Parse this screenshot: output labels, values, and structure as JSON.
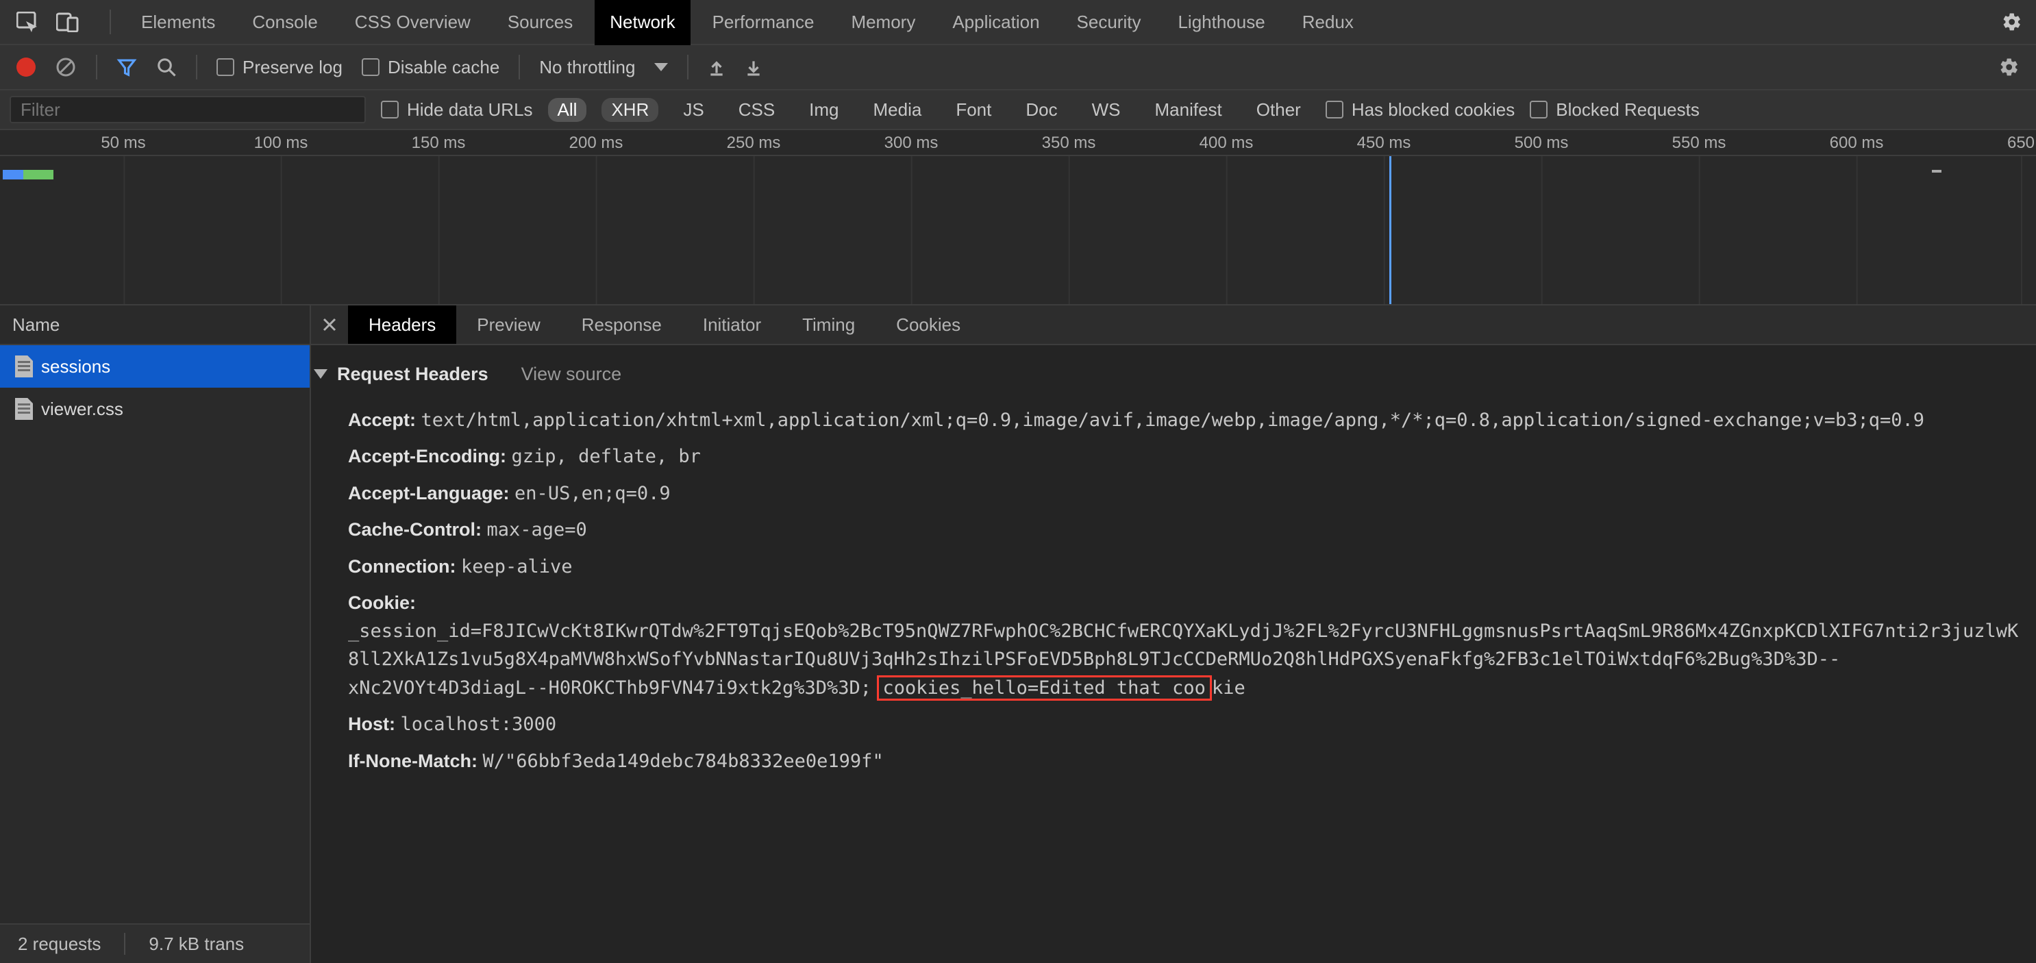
{
  "topTabs": {
    "items": [
      "Elements",
      "Console",
      "CSS Overview",
      "Sources",
      "Network",
      "Performance",
      "Memory",
      "Application",
      "Security",
      "Lighthouse",
      "Redux"
    ],
    "activeIndex": 4
  },
  "toolbar": {
    "preserveLog": "Preserve log",
    "disableCache": "Disable cache",
    "throttling": "No throttling"
  },
  "filterRow": {
    "placeholder": "Filter",
    "hideDataUrls": "Hide data URLs",
    "types": [
      "All",
      "XHR",
      "JS",
      "CSS",
      "Img",
      "Media",
      "Font",
      "Doc",
      "WS",
      "Manifest",
      "Other"
    ],
    "typeActiveIndex": 0,
    "typeSemiIndex": 1,
    "hasBlockedCookies": "Has blocked cookies",
    "blockedRequests": "Blocked Requests"
  },
  "timeline": {
    "ticks": [
      "50 ms",
      "100 ms",
      "150 ms",
      "200 ms",
      "250 ms",
      "300 ms",
      "350 ms",
      "400 ms",
      "450 ms",
      "500 ms",
      "550 ms",
      "600 ms",
      "650"
    ]
  },
  "sidebar": {
    "header": "Name",
    "requests": [
      {
        "name": "sessions",
        "selected": true
      },
      {
        "name": "viewer.css",
        "selected": false
      }
    ]
  },
  "detailTabs": {
    "items": [
      "Headers",
      "Preview",
      "Response",
      "Initiator",
      "Timing",
      "Cookies"
    ],
    "activeIndex": 0
  },
  "section": {
    "title": "Request Headers",
    "viewSource": "View source"
  },
  "headers": {
    "accept": {
      "name": "Accept:",
      "value": "text/html,application/xhtml+xml,application/xml;q=0.9,image/avif,image/webp,image/apng,*/*;q=0.8,application/signed-exchange;v=b3;q=0.9"
    },
    "acceptEncoding": {
      "name": "Accept-Encoding:",
      "value": "gzip, deflate, br"
    },
    "acceptLanguage": {
      "name": "Accept-Language:",
      "value": "en-US,en;q=0.9"
    },
    "cacheControl": {
      "name": "Cache-Control:",
      "value": "max-age=0"
    },
    "connection": {
      "name": "Connection:",
      "value": "keep-alive"
    },
    "cookie": {
      "name": "Cookie:",
      "pre": "_session_id=F8JICwVcKt8IKwrQTdw%2FT9TqjsEQob%2BcT95nQWZ7RFwphOC%2BCHCfwERCQYXaKLydjJ%2FL%2FyrcU3NFHLggmsnusPsrtAaqSmL9R86Mx4ZGnxpKCDlXIFG7nti2r3juzlwK8ll2XkA1Zs1vu5g8X4paMVW8hxWSofYvbNNastarIQu8UVj3qHh2sIhzilPSFoEVD5Bph8L9TJcCCDeRMUo2Q8hlHdPGXSyenaFkfg%2FB3c1elTOiWxtdqF6%2Bug%3D%3D--xNc2VOYt4D3diagL--H0ROKCThb9FVN47i9xtk2g%3D%3D;",
      "highlight": "cookies_hello=Edited that coo",
      "post": "kie"
    },
    "host": {
      "name": "Host:",
      "value": "localhost:3000"
    },
    "ifNoneMatch": {
      "name": "If-None-Match:",
      "value": "W/\"66bbf3eda149debc784b8332ee0e199f\""
    }
  },
  "status": {
    "requests": "2 requests",
    "transfer": "9.7 kB trans"
  }
}
